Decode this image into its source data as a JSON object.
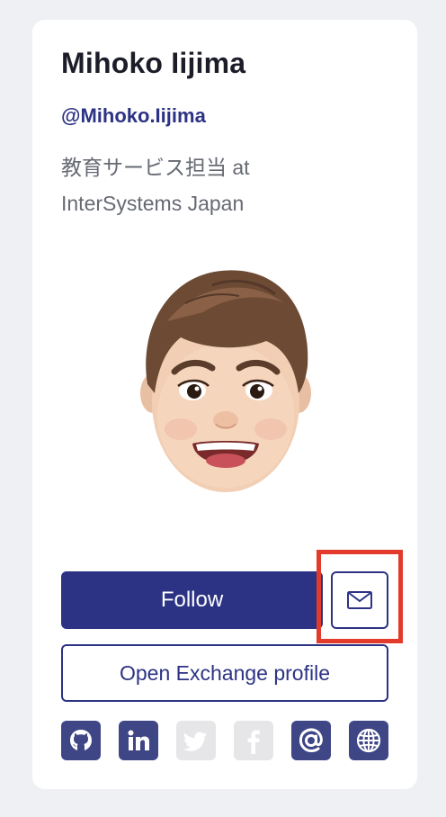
{
  "profile": {
    "name": "Mihoko Iijima",
    "handle": "@Mihoko.Iijima",
    "bio_line1": "教育サービス担当 at",
    "bio_line2": "InterSystems Japan",
    "avatar": "memoji-avatar"
  },
  "actions": {
    "follow_label": "Follow",
    "message_icon": "envelope-icon",
    "exchange_label": "Open Exchange profile"
  },
  "socials": [
    {
      "name": "github",
      "icon": "github-icon",
      "enabled": true
    },
    {
      "name": "linkedin",
      "icon": "linkedin-icon",
      "enabled": true
    },
    {
      "name": "twitter",
      "icon": "twitter-icon",
      "enabled": false
    },
    {
      "name": "facebook",
      "icon": "facebook-icon",
      "enabled": false
    },
    {
      "name": "email",
      "icon": "at-sign-icon",
      "enabled": true
    },
    {
      "name": "website",
      "icon": "globe-icon",
      "enabled": true
    }
  ],
  "colors": {
    "brand": "#2d3384",
    "highlight": "#e33b2b",
    "social_active": "#3f4686",
    "social_inactive": "#e6e6e8",
    "page_bg": "#eef0f3"
  }
}
